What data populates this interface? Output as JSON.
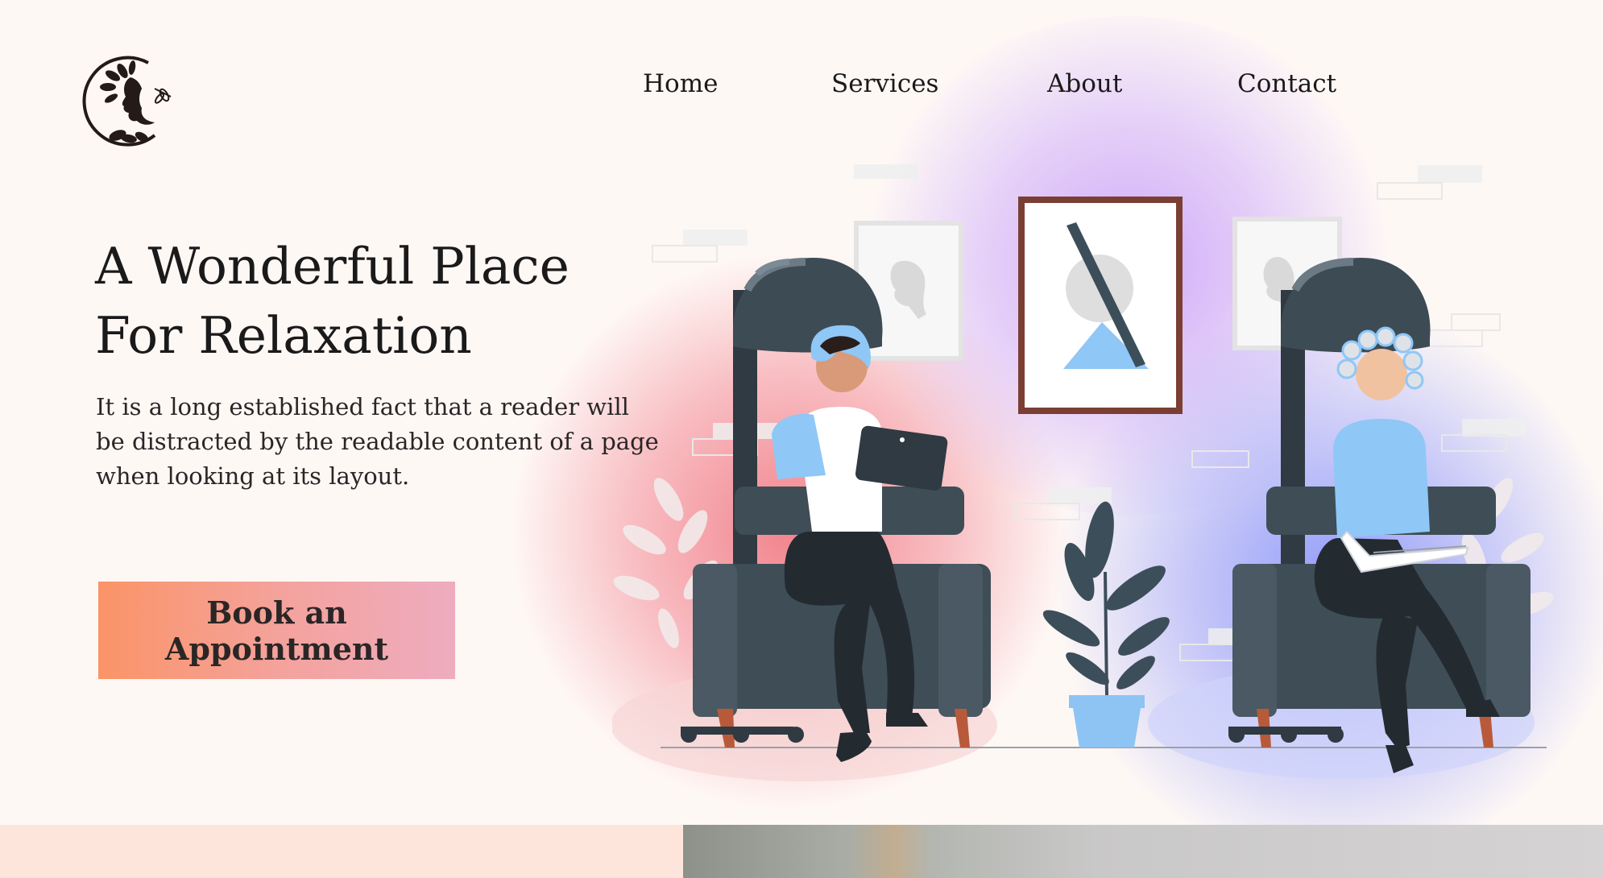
{
  "brand": {
    "logo_icon": "woman-profile-leaves-logo"
  },
  "nav": {
    "items": [
      {
        "label": "Home"
      },
      {
        "label": "Services"
      },
      {
        "label": "About"
      },
      {
        "label": "Contact"
      }
    ]
  },
  "hero": {
    "title_line1": "A Wonderful Place",
    "title_line2": "For Relaxation",
    "description": "It is a long established fact that a reader will be distracted by the readable content of a page when looking at its layout.",
    "cta_label": "Book an Appointment",
    "illustration": "hair-salon-illustration"
  },
  "colors": {
    "background": "#fef8f5",
    "cta_gradient_start": "#fb9467",
    "cta_gradient_end": "#eeacc0",
    "text": "#1b1a1a",
    "glow_pink": "#f07882",
    "glow_purple": "#c8a0fa",
    "glow_blue": "#8c96fa",
    "bottom_band": "#fde5dc"
  }
}
